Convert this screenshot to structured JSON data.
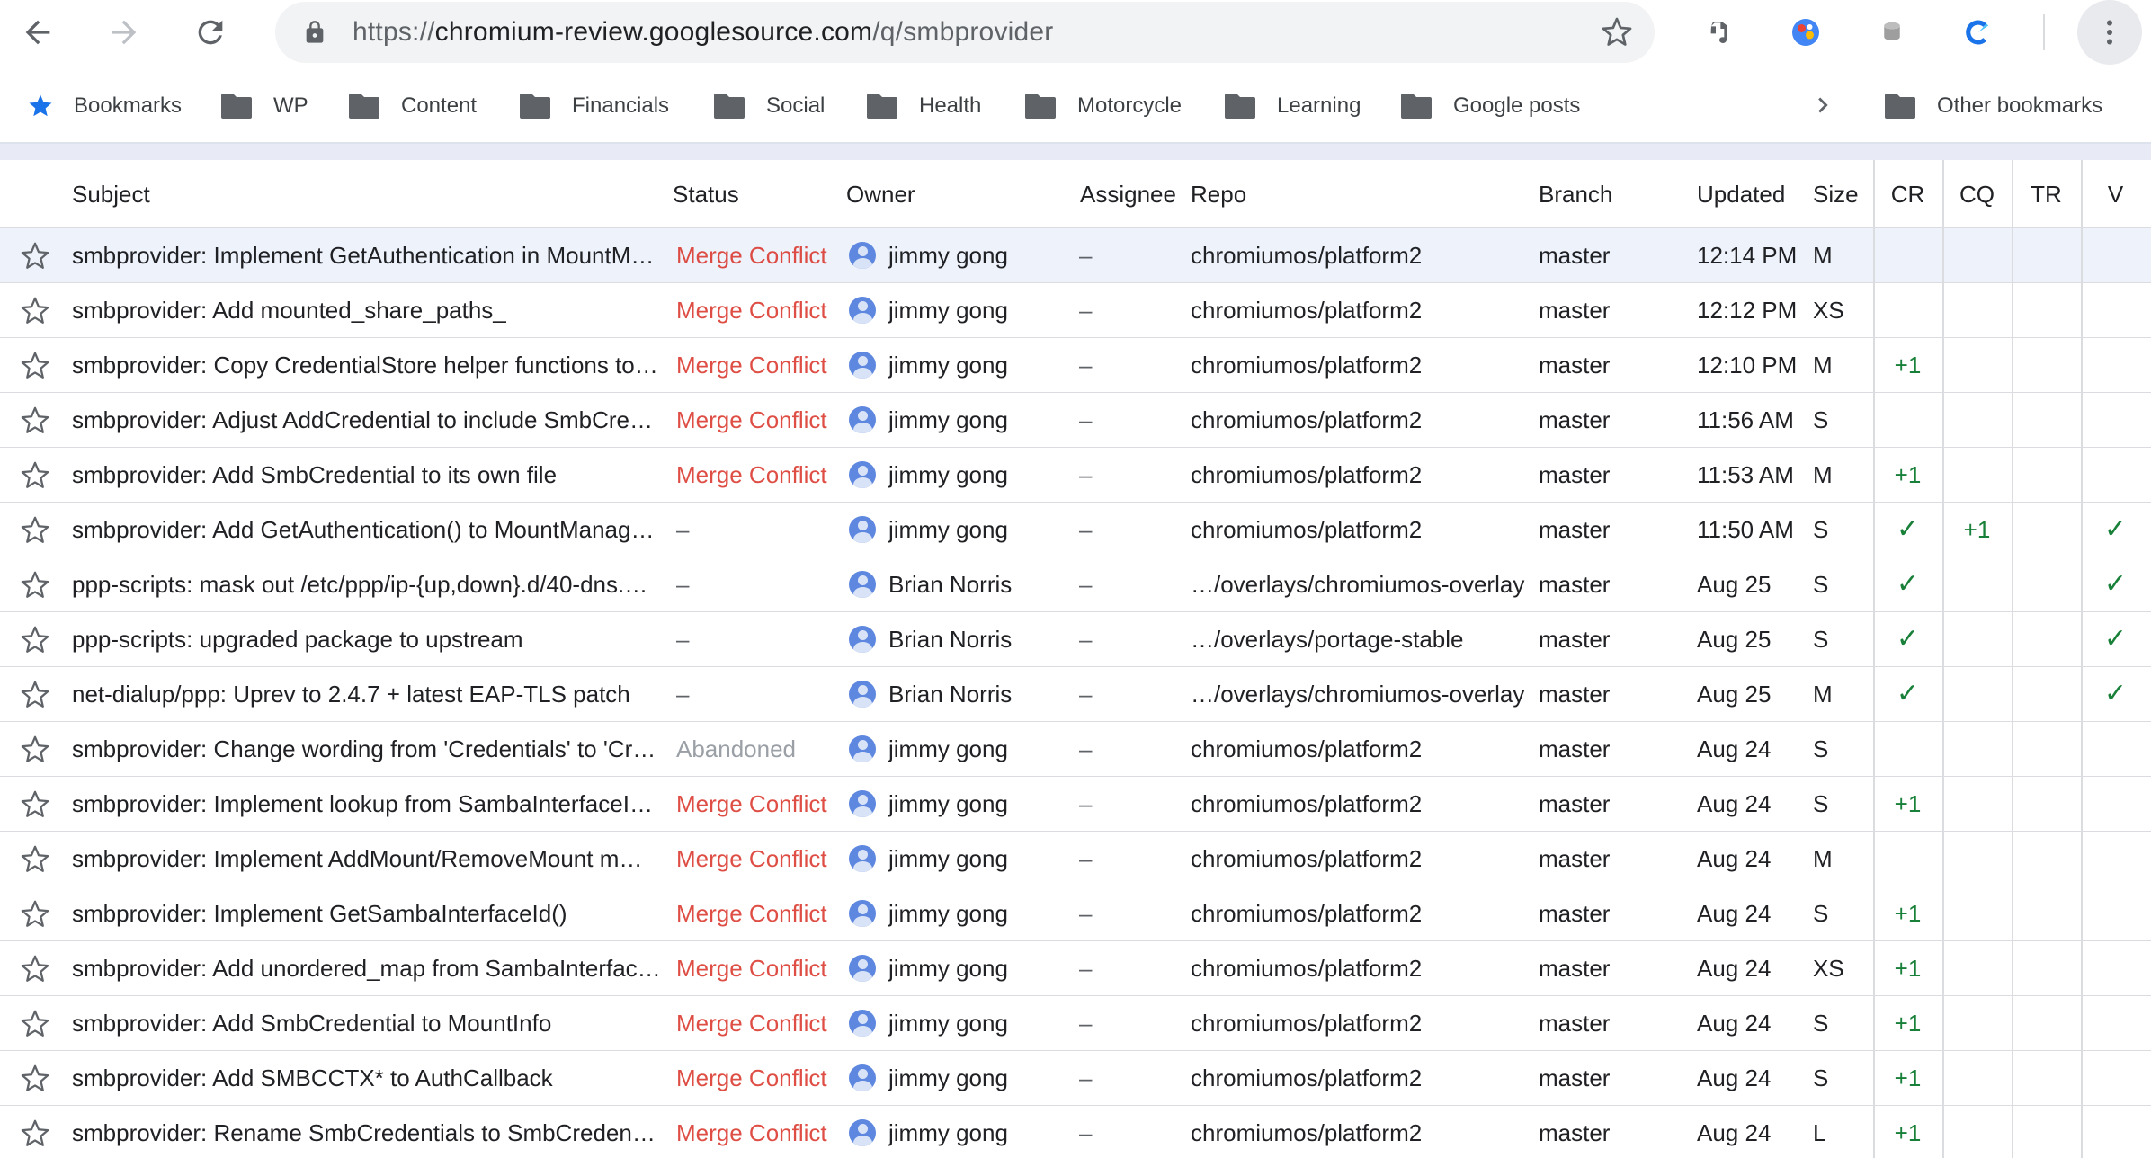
{
  "browser": {
    "url_scheme": "https://",
    "url_host": "chromium-review.googlesource.com",
    "url_path": "/q/smbprovider"
  },
  "bookmarks": {
    "items": [
      {
        "label": "Bookmarks",
        "icon": "star-icon"
      },
      {
        "label": "WP",
        "icon": "folder-icon"
      },
      {
        "label": "Content",
        "icon": "folder-icon"
      },
      {
        "label": "Financials",
        "icon": "folder-icon"
      },
      {
        "label": "Social",
        "icon": "folder-icon"
      },
      {
        "label": "Health",
        "icon": "folder-icon"
      },
      {
        "label": "Motorcycle",
        "icon": "folder-icon"
      },
      {
        "label": "Learning",
        "icon": "folder-icon"
      },
      {
        "label": "Google posts",
        "icon": "folder-icon"
      }
    ],
    "other": "Other bookmarks"
  },
  "table": {
    "columns": {
      "subject": "Subject",
      "status": "Status",
      "owner": "Owner",
      "assignee": "Assignee",
      "repo": "Repo",
      "branch": "Branch",
      "updated": "Updated",
      "size": "Size",
      "cr": "CR",
      "cq": "CQ",
      "tr": "TR",
      "v": "V"
    },
    "rows": [
      {
        "subject": "smbprovider: Implement GetAuthentication in MountM…",
        "status": "Merge Conflict",
        "owner": "jimmy gong",
        "assignee": "–",
        "repo": "chromiumos/platform2",
        "branch": "master",
        "updated": "12:14 PM",
        "size": "M",
        "cr": "",
        "cq": "",
        "tr": "",
        "v": ""
      },
      {
        "subject": "smbprovider: Add mounted_share_paths_",
        "status": "Merge Conflict",
        "owner": "jimmy gong",
        "assignee": "–",
        "repo": "chromiumos/platform2",
        "branch": "master",
        "updated": "12:12 PM",
        "size": "XS",
        "cr": "",
        "cq": "",
        "tr": "",
        "v": ""
      },
      {
        "subject": "smbprovider: Copy CredentialStore helper functions to …",
        "status": "Merge Conflict",
        "owner": "jimmy gong",
        "assignee": "–",
        "repo": "chromiumos/platform2",
        "branch": "master",
        "updated": "12:10 PM",
        "size": "M",
        "cr": "+1",
        "cq": "",
        "tr": "",
        "v": ""
      },
      {
        "subject": "smbprovider: Adjust AddCredential to include SmbCre…",
        "status": "Merge Conflict",
        "owner": "jimmy gong",
        "assignee": "–",
        "repo": "chromiumos/platform2",
        "branch": "master",
        "updated": "11:56 AM",
        "size": "S",
        "cr": "",
        "cq": "",
        "tr": "",
        "v": ""
      },
      {
        "subject": "smbprovider: Add SmbCredential to its own file",
        "status": "Merge Conflict",
        "owner": "jimmy gong",
        "assignee": "–",
        "repo": "chromiumos/platform2",
        "branch": "master",
        "updated": "11:53 AM",
        "size": "M",
        "cr": "+1",
        "cq": "",
        "tr": "",
        "v": ""
      },
      {
        "subject": "smbprovider: Add GetAuthentication() to MountManag…",
        "status": "–",
        "owner": "jimmy gong",
        "assignee": "–",
        "repo": "chromiumos/platform2",
        "branch": "master",
        "updated": "11:50 AM",
        "size": "S",
        "cr": "✓",
        "cq": "+1",
        "tr": "",
        "v": "✓"
      },
      {
        "subject": "ppp-scripts: mask out /etc/ppp/ip-{up,down}.d/40-dns.…",
        "status": "–",
        "owner": "Brian Norris",
        "assignee": "–",
        "repo": "…/overlays/chromiumos-overlay",
        "branch": "master",
        "updated": "Aug 25",
        "size": "S",
        "cr": "✓",
        "cq": "",
        "tr": "",
        "v": "✓"
      },
      {
        "subject": "ppp-scripts: upgraded package to upstream",
        "status": "–",
        "owner": "Brian Norris",
        "assignee": "–",
        "repo": "…/overlays/portage-stable",
        "branch": "master",
        "updated": "Aug 25",
        "size": "S",
        "cr": "✓",
        "cq": "",
        "tr": "",
        "v": "✓"
      },
      {
        "subject": "net-dialup/ppp: Uprev to 2.4.7 + latest EAP-TLS patch",
        "status": "–",
        "owner": "Brian Norris",
        "assignee": "–",
        "repo": "…/overlays/chromiumos-overlay",
        "branch": "master",
        "updated": "Aug 25",
        "size": "M",
        "cr": "✓",
        "cq": "",
        "tr": "",
        "v": "✓"
      },
      {
        "subject": "smbprovider: Change wording from 'Credentials' to 'Cr…",
        "status": "Abandoned",
        "owner": "jimmy gong",
        "assignee": "–",
        "repo": "chromiumos/platform2",
        "branch": "master",
        "updated": "Aug 24",
        "size": "S",
        "cr": "",
        "cq": "",
        "tr": "",
        "v": ""
      },
      {
        "subject": "smbprovider: Implement lookup from SambaInterfaceI…",
        "status": "Merge Conflict",
        "owner": "jimmy gong",
        "assignee": "–",
        "repo": "chromiumos/platform2",
        "branch": "master",
        "updated": "Aug 24",
        "size": "S",
        "cr": "+1",
        "cq": "",
        "tr": "",
        "v": ""
      },
      {
        "subject": "smbprovider: Implement AddMount/RemoveMount m…",
        "status": "Merge Conflict",
        "owner": "jimmy gong",
        "assignee": "–",
        "repo": "chromiumos/platform2",
        "branch": "master",
        "updated": "Aug 24",
        "size": "M",
        "cr": "",
        "cq": "",
        "tr": "",
        "v": ""
      },
      {
        "subject": "smbprovider: Implement GetSambaInterfaceId()",
        "status": "Merge Conflict",
        "owner": "jimmy gong",
        "assignee": "–",
        "repo": "chromiumos/platform2",
        "branch": "master",
        "updated": "Aug 24",
        "size": "S",
        "cr": "+1",
        "cq": "",
        "tr": "",
        "v": ""
      },
      {
        "subject": "smbprovider: Add unordered_map from SambaInterfac…",
        "status": "Merge Conflict",
        "owner": "jimmy gong",
        "assignee": "–",
        "repo": "chromiumos/platform2",
        "branch": "master",
        "updated": "Aug 24",
        "size": "XS",
        "cr": "+1",
        "cq": "",
        "tr": "",
        "v": ""
      },
      {
        "subject": "smbprovider: Add SmbCredential to MountInfo",
        "status": "Merge Conflict",
        "owner": "jimmy gong",
        "assignee": "–",
        "repo": "chromiumos/platform2",
        "branch": "master",
        "updated": "Aug 24",
        "size": "S",
        "cr": "+1",
        "cq": "",
        "tr": "",
        "v": ""
      },
      {
        "subject": "smbprovider: Add SMBCCTX* to AuthCallback",
        "status": "Merge Conflict",
        "owner": "jimmy gong",
        "assignee": "–",
        "repo": "chromiumos/platform2",
        "branch": "master",
        "updated": "Aug 24",
        "size": "S",
        "cr": "+1",
        "cq": "",
        "tr": "",
        "v": ""
      },
      {
        "subject": "smbprovider: Rename SmbCredentials to SmbCredential",
        "status": "Merge Conflict",
        "owner": "jimmy gong",
        "assignee": "–",
        "repo": "chromiumos/platform2",
        "branch": "master",
        "updated": "Aug 24",
        "size": "L",
        "cr": "+1",
        "cq": "",
        "tr": "",
        "v": ""
      }
    ]
  },
  "colors": {
    "merge_conflict": "#d93025",
    "abandoned": "#9aa0a6",
    "vote_positive": "#188038",
    "highlight_row": "#eef2fb",
    "star_blue": "#1a73e8"
  }
}
